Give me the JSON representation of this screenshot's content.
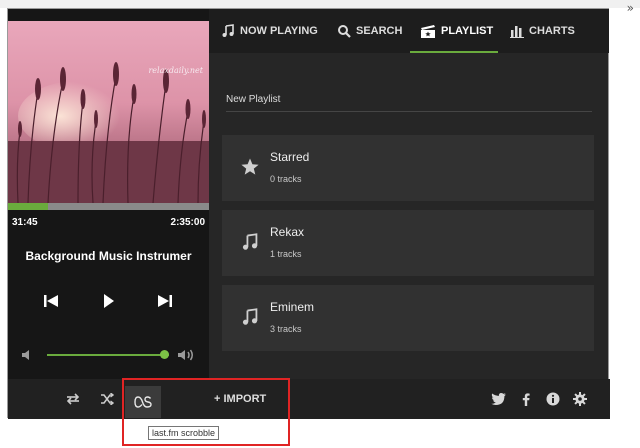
{
  "browser": {
    "overflow_label": "»"
  },
  "player": {
    "watermark": "relaxdaily.net",
    "current_time": "31:45",
    "total_time": "2:35:00",
    "progress_fraction": 0.2,
    "track_title": "Background Music Instrumer",
    "volume_fraction": 0.96
  },
  "nav": {
    "tabs": [
      {
        "label": "NOW PLAYING",
        "icon": "music-note-icon"
      },
      {
        "label": "SEARCH",
        "icon": "search-icon"
      },
      {
        "label": "PLAYLIST",
        "icon": "playlist-icon",
        "active": true
      },
      {
        "label": "CHARTS",
        "icon": "charts-icon"
      }
    ]
  },
  "playlist_panel": {
    "title": "New Playlist",
    "items": [
      {
        "name": "Starred",
        "count": "0 tracks",
        "icon": "star-icon"
      },
      {
        "name": "Rekax",
        "count": "1 tracks",
        "icon": "music-note-icon"
      },
      {
        "name": "Eminem",
        "count": "3 tracks",
        "icon": "music-note-icon"
      }
    ]
  },
  "footer": {
    "import_label": "+ IMPORT",
    "tooltip": "last.fm scrobble"
  },
  "colors": {
    "accent": "#6aab3d",
    "background": "#262626",
    "card": "#313131",
    "highlight": "#e02424"
  }
}
